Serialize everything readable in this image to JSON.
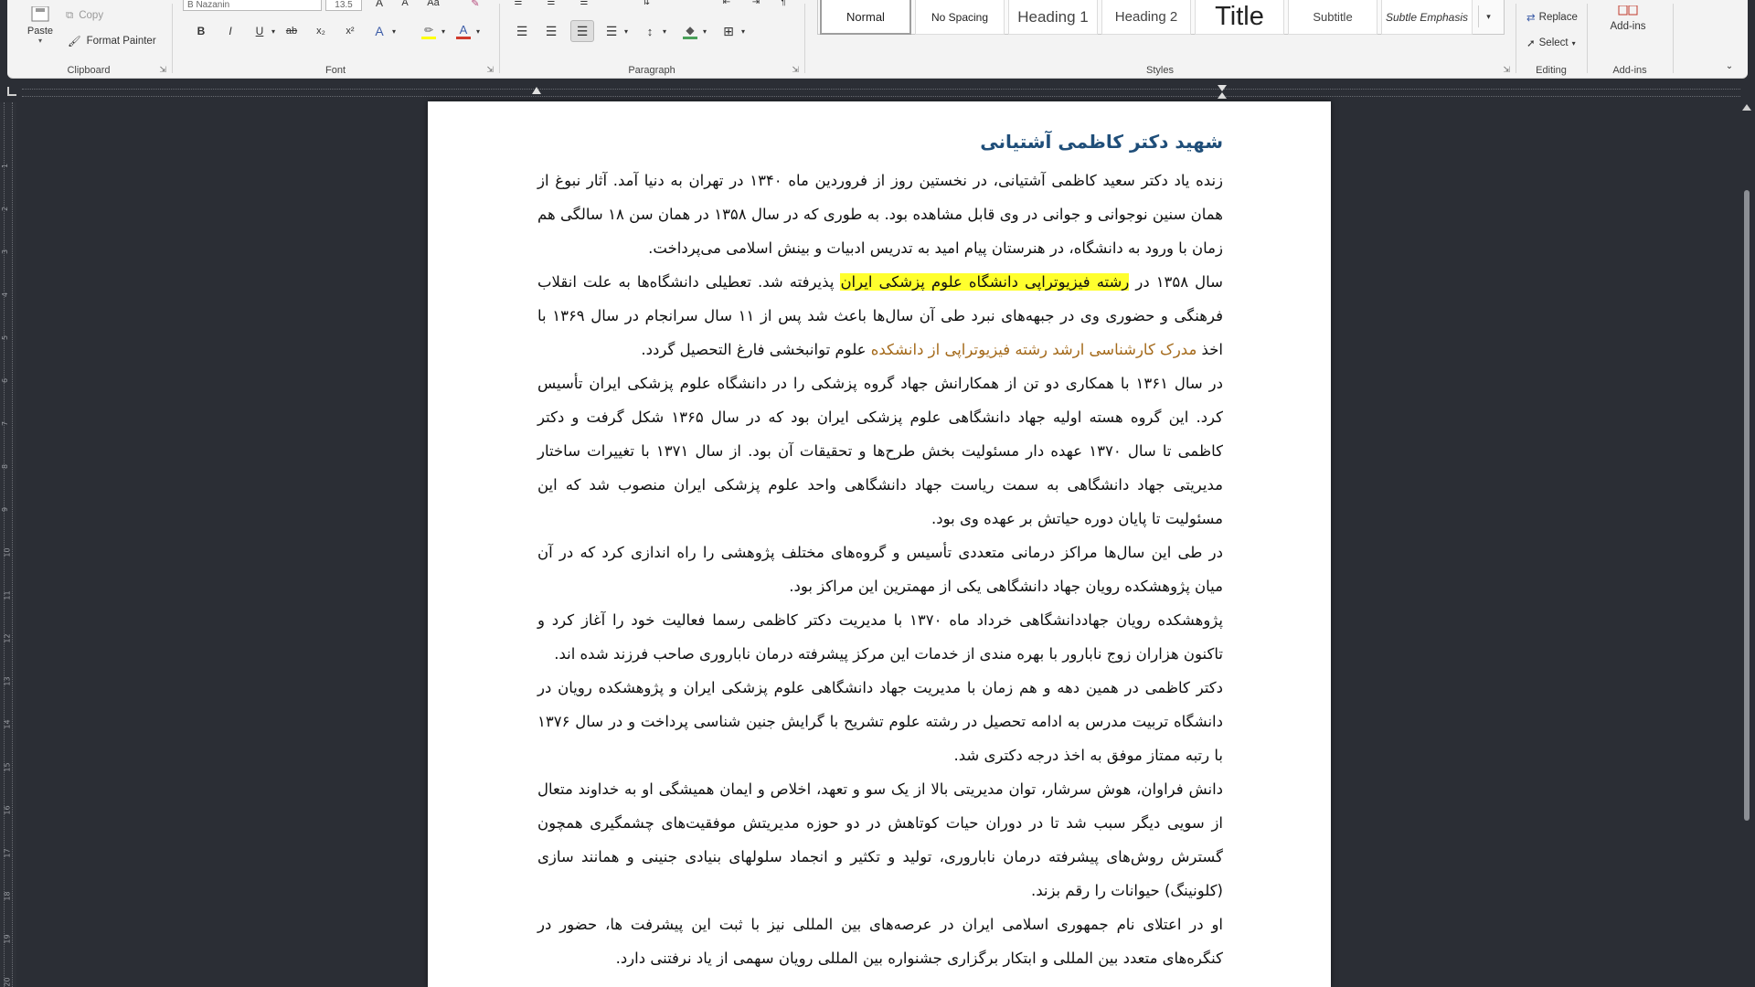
{
  "ribbon": {
    "clipboard": {
      "paste_label": "Paste",
      "copy_label": "Copy",
      "format_painter_label": "Format Painter",
      "group_label": "Clipboard"
    },
    "font": {
      "font_name": "B Nazanin",
      "font_size": "13.5",
      "group_label": "Font",
      "buttons": [
        "B",
        "I",
        "U",
        "ab",
        "x₂",
        "x²",
        "A"
      ]
    },
    "paragraph": {
      "group_label": "Paragraph"
    },
    "styles": {
      "group_label": "Styles",
      "items": [
        "Normal",
        "No Spacing",
        "Heading 1",
        "Heading 2",
        "Title",
        "Subtitle",
        "Subtle Emphasis"
      ]
    },
    "editing": {
      "replace_label": "Replace",
      "select_label": "Select",
      "group_label": "Editing"
    },
    "addins": {
      "label": "Add-ins",
      "group_label": "Add-ins"
    },
    "colors": {
      "highlight": "#ffff00",
      "font_color": "#d03a2c"
    }
  },
  "ruler": {
    "vertical_ticks": [
      "1",
      "2",
      "3",
      "4",
      "5",
      "6",
      "7",
      "8",
      "9",
      "10",
      "11",
      "12",
      "13",
      "14",
      "15",
      "16",
      "17",
      "18",
      "19",
      "20"
    ]
  },
  "document": {
    "title": "شهید دکتر کاظمی آشتیانی",
    "p1": "زنده یاد دکتر سعید کاظمی آشتیانی، در نخستین روز از فروردین ماه ۱۳۴۰ در تهران به دنیا آمد. آثار نبوغ از همان سنین نوجوانی و جوانی در وی قابل مشاهده بود. به طوری که در سال ۱۳۵۸ در همان سن ۱۸ سالگی هم زمان با ورود به دانشگاه، در هنرستان پیام امید به تدریس ادبیات و بینش اسلامی می‌پرداخت.",
    "p2_before": "سال ۱۳۵۸ در ",
    "p2_highlight": "رشته فیزیوتراپی دانشگاه علوم پزشکی ایران",
    "p2_middle": " پذیرفته شد. تعطیلی دانشگاه‌ها به علت انقلاب فرهنگی و حضوری وی در جبهه‌های نبرد طی آن سال‌ها باعث شد پس از ۱۱ سال سرانجام در سال ۱۳۶۹ با اخذ ",
    "p2_tracked": "مدرک کارشناسی ارشد رشته فیزیوتراپی از دانشکده",
    "p2_after": " علوم توانبخشی فارغ التحصیل گردد.",
    "p3": "در سال ۱۳۶۱ با همکاری دو تن از همکارانش جهاد گروه پزشکی را در دانشگاه علوم پزشکی ایران تأسیس کرد. این گروه هسته اولیه جهاد دانشگاهی علوم پزشکی ایران بود که در سال ۱۳۶۵ شکل گرفت و دکتر کاظمی تا سال ۱۳۷۰ عهده دار مسئولیت بخش طرح‌ها و تحقیقات آن بود. از سال ۱۳۷۱ با تغییرات ساختار مدیریتی جهاد دانشگاهی به سمت ریاست جهاد دانشگاهی واحد علوم پزشکی ایران منصوب شد که این مسئولیت تا پایان دوره حیاتش بر عهده وی بود.",
    "p4": "در طی این سال‌ها مراکز درمانی متعددی تأسیس و گروه‌های مختلف پژوهشی را راه اندازی کرد که در آن میان پژوهشکده رویان جهاد دانشگاهی یکی از مهمترین این مراکز بود.",
    "p5": "پژوهشکده رویان جهاددانشگاهی خرداد ماه ۱۳۷۰ با مدیریت دکتر کاظمی رسما فعالیت خود را آغاز کرد و تاکنون هزاران زوج نابارور با بهره مندی از خدمات این مرکز پیشرفته درمان ناباروری صاحب فرزند شده اند.",
    "p6": "دکتر کاظمی در همین دهه و هم زمان با مدیریت جهاد دانشگاهی علوم پزشکی ایران و پژوهشکده رویان در دانشگاه تربیت مدرس به ادامه تحصیل در رشته علوم تشریح با گرایش جنین شناسی پرداخت و در سال ۱۳۷۶ با رتبه ممتاز موفق به اخذ درجه دکتری شد.",
    "p7": "دانش فراوان، هوش سرشار، توان مدیریتی بالا از یک سو و تعهد، اخلاص و ایمان همیشگی او به خداوند متعال از سویی دیگر سبب شد تا در دوران حیات کوتاهش در دو حوزه مدیریتش موفقیت‌های چشمگیری همچون گسترش روش‌های پیشرفته درمان ناباروری، تولید و تکثیر و انجماد سلولهای بنیادی جنینی و همانند سازی (کلونینگ) حیوانات را رقم بزند.",
    "p8": "او در اعتلای نام جمهوری اسلامی ایران در عرصه‌های بین المللی نیز با ثبت این پیشرفت ها، حضور در کنگره‌های متعدد بین المللی و ابتکار برگزاری جشنواره بین المللی رویان سهمی از یاد نرفتنی دارد."
  }
}
